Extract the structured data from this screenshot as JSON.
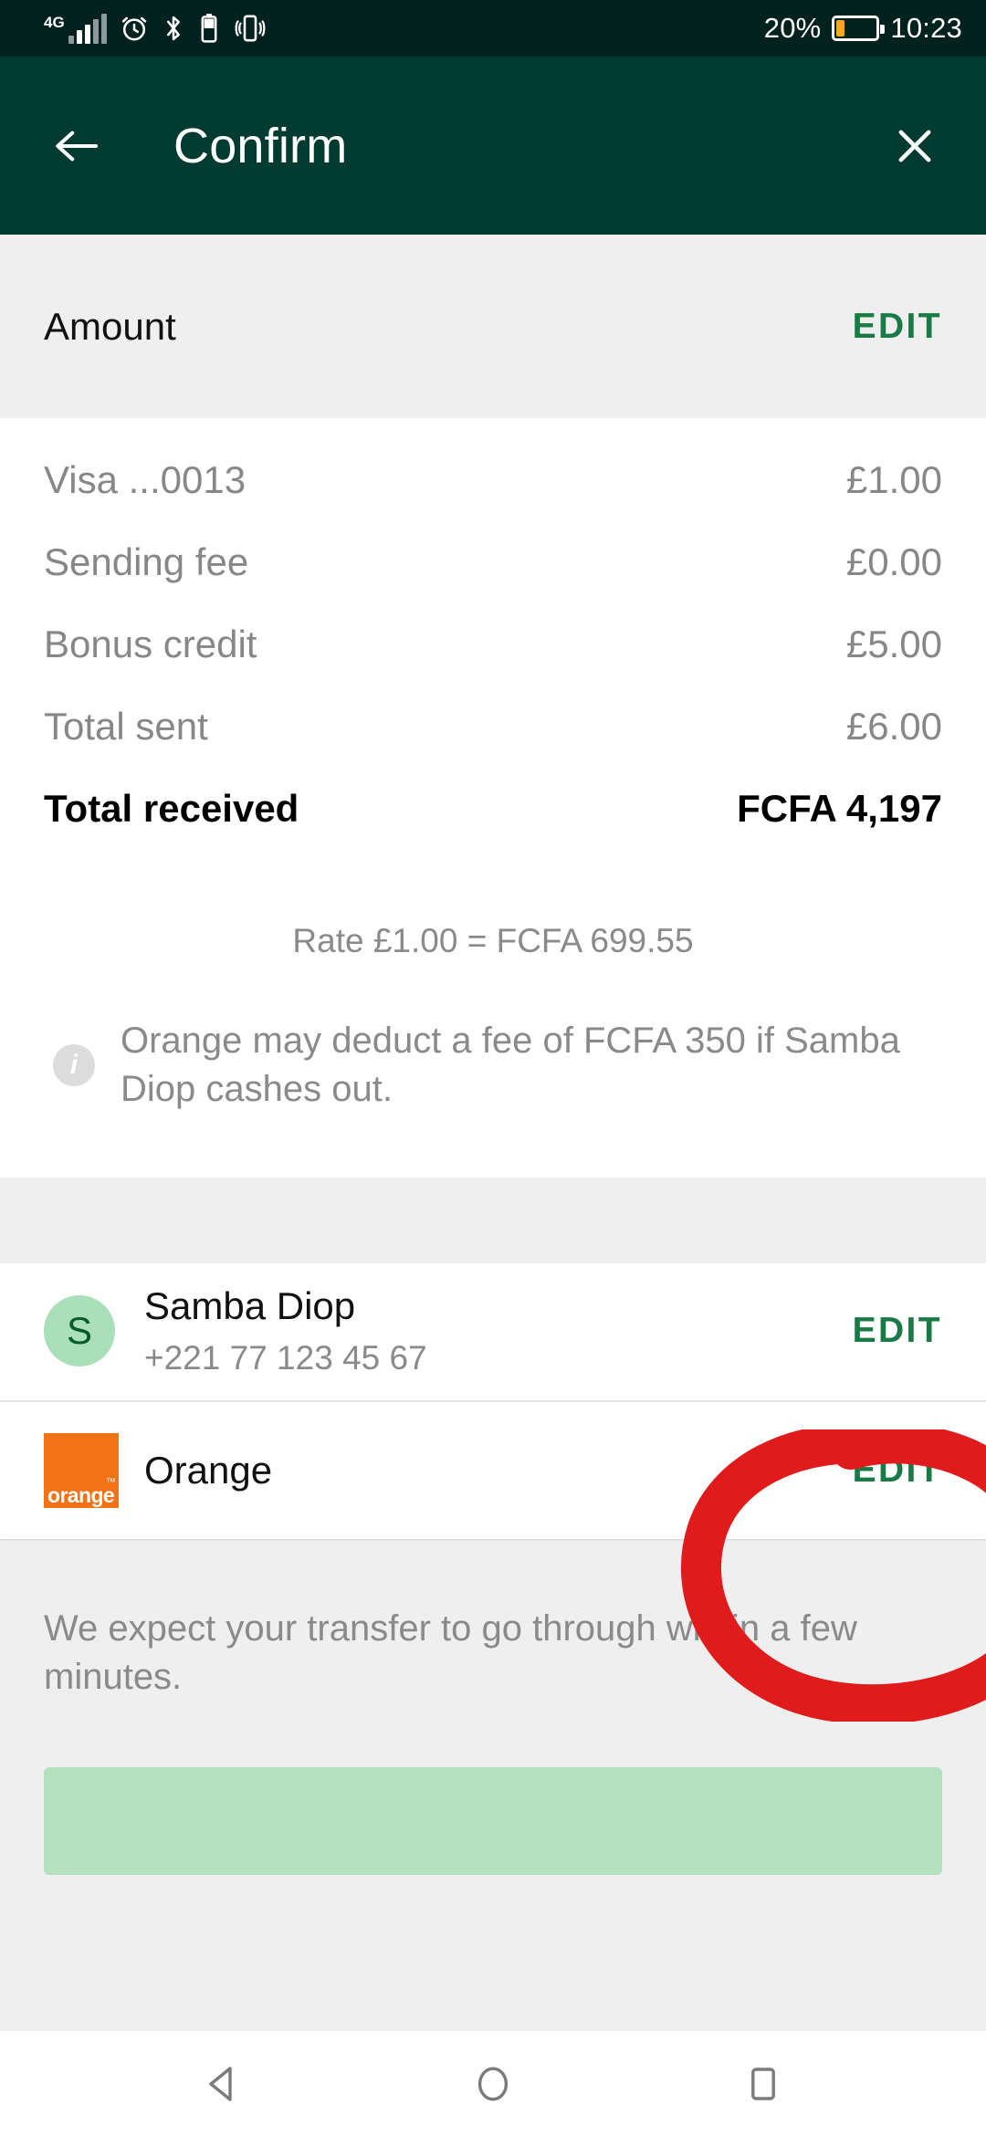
{
  "status_bar": {
    "network_label": "4G",
    "battery_percent": "20%",
    "time": "10:23",
    "icons": [
      "signal-icon",
      "alarm-icon",
      "bluetooth-icon",
      "battery-saver-icon",
      "vibrate-icon"
    ],
    "battery_level": 20,
    "battery_color": "#f5a623",
    "background": "#00221e"
  },
  "header": {
    "title": "Confirm",
    "back_icon": "arrow-left-icon",
    "close_icon": "close-icon",
    "background": "#003b31"
  },
  "amount_section": {
    "label": "Amount",
    "edit_label": "EDIT",
    "rows": [
      {
        "key": "Visa ...0013",
        "value": "£1.00"
      },
      {
        "key": "Sending fee",
        "value": "£0.00"
      },
      {
        "key": "Bonus credit",
        "value": "£5.00"
      },
      {
        "key": "Total sent",
        "value": "£6.00"
      },
      {
        "key": "Total received",
        "value": "FCFA 4,197"
      }
    ],
    "rate": "Rate £1.00 = FCFA 699.55",
    "note": "Orange may deduct a fee of FCFA 350 if Samba Diop cashes out.",
    "info_icon_glyph": "i"
  },
  "recipient_section": {
    "avatar_initial": "S",
    "name": "Samba Diop",
    "phone": "+221 77 123 45 67",
    "edit_label": "EDIT",
    "provider_name": "Orange",
    "provider_logo_text": "orange",
    "provider_logo_tm": "™",
    "provider_edit_label": "EDIT",
    "provider_color": "#f47216"
  },
  "footer": {
    "note": "We expect your transfer to go through within a few minutes.",
    "cta_color": "#b4e0bf"
  },
  "annotation": {
    "shape": "hand-drawn-circle",
    "color": "#e01b1b",
    "target": "provider-edit-button"
  },
  "nav_bar": {
    "back_icon": "nav-back-icon",
    "home_icon": "nav-home-icon",
    "recents_icon": "nav-recents-icon"
  },
  "colors": {
    "accent_green": "#1a7a45",
    "header_green": "#003b31",
    "page_background": "#efefef"
  }
}
